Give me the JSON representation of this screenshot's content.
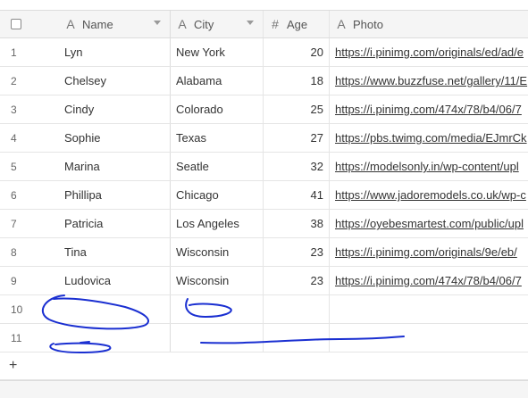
{
  "columns": {
    "name": {
      "label": "Name",
      "icon": "text-field-icon"
    },
    "city": {
      "label": "City",
      "icon": "text-field-icon"
    },
    "age": {
      "label": "Age",
      "icon": "number-field-icon"
    },
    "photo": {
      "label": "Photo",
      "icon": "text-field-icon"
    }
  },
  "rows": [
    {
      "num": "1",
      "name": "Lyn",
      "city": "New York",
      "age": "20",
      "photo": "https://i.pinimg.com/originals/ed/ad/e"
    },
    {
      "num": "2",
      "name": "Chelsey",
      "city": "Alabama",
      "age": "18",
      "photo": "https://www.buzzfuse.net/gallery/11/E"
    },
    {
      "num": "3",
      "name": "Cindy",
      "city": "Colorado",
      "age": "25",
      "photo": "https://i.pinimg.com/474x/78/b4/06/7"
    },
    {
      "num": "4",
      "name": "Sophie",
      "city": "Texas",
      "age": "27",
      "photo": "https://pbs.twimg.com/media/EJmrCk"
    },
    {
      "num": "5",
      "name": "Marina",
      "city": "Seatle",
      "age": "32",
      "photo": "https://modelsonly.in/wp-content/upl"
    },
    {
      "num": "6",
      "name": "Phillipa",
      "city": "Chicago",
      "age": "41",
      "photo": "https://www.jadoremodels.co.uk/wp-c"
    },
    {
      "num": "7",
      "name": "Patricia",
      "city": "Los Angeles",
      "age": "38",
      "photo": "https://oyebesmartest.com/public/upl"
    },
    {
      "num": "8",
      "name": "Tina",
      "city": "Wisconsin",
      "age": "23",
      "photo": "https://i.pinimg.com/originals/9e/eb/"
    },
    {
      "num": "9",
      "name": "Ludovica",
      "city": "Wisconsin",
      "age": "23",
      "photo": "https://i.pinimg.com/474x/78/b4/06/7"
    },
    {
      "num": "10",
      "name": "",
      "city": "",
      "age": "",
      "photo": ""
    },
    {
      "num": "11",
      "name": "",
      "city": "",
      "age": "",
      "photo": ""
    }
  ],
  "add_row_label": "+",
  "annotations": {
    "color": "#1a2fd1"
  }
}
